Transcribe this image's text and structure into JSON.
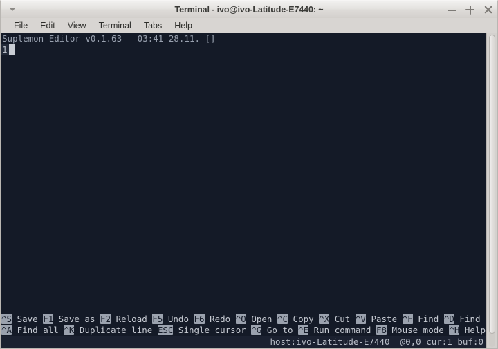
{
  "window": {
    "title": "Terminal - ivo@ivo-Latitude-E7440: ~",
    "menu_icon": "chevron-down-icon",
    "controls": {
      "minimize": "minimize-icon",
      "maximize": "maximize-icon",
      "close": "close-icon"
    }
  },
  "menubar": {
    "items": [
      {
        "label": "File"
      },
      {
        "label": "Edit"
      },
      {
        "label": "View"
      },
      {
        "label": "Terminal"
      },
      {
        "label": "Tabs"
      },
      {
        "label": "Help"
      }
    ]
  },
  "editor": {
    "header": "Suplemon Editor v0.1.63 - 03:41 28.11. []",
    "line_number": "1",
    "line_text": "",
    "cursor": "block-cursor"
  },
  "shortcuts": {
    "row1": [
      {
        "key": "^S",
        "label": "Save"
      },
      {
        "key": "F1",
        "label": "Save as"
      },
      {
        "key": "F2",
        "label": "Reload"
      },
      {
        "key": "F5",
        "label": "Undo"
      },
      {
        "key": "F6",
        "label": "Redo"
      },
      {
        "key": "^O",
        "label": "Open"
      },
      {
        "key": "^C",
        "label": "Copy"
      },
      {
        "key": "^X",
        "label": "Cut"
      },
      {
        "key": "^V",
        "label": "Paste"
      },
      {
        "key": "^F",
        "label": "Find"
      },
      {
        "key": "^D",
        "label": "Find next"
      }
    ],
    "row2": [
      {
        "key": "^A",
        "label": "Find all"
      },
      {
        "key": "^K",
        "label": "Duplicate line"
      },
      {
        "key": "ESC",
        "label": "Single cursor"
      },
      {
        "key": "^G",
        "label": "Go to"
      },
      {
        "key": "^E",
        "label": "Run command"
      },
      {
        "key": "F8",
        "label": "Mouse mode"
      },
      {
        "key": "^H",
        "label": "Help"
      }
    ]
  },
  "status": {
    "host": "host:ivo-Latitude-E7440",
    "position": "@0,0",
    "cursors": "cur:1",
    "buffer": "buf:0",
    "full": "host:ivo-Latitude-E7440  @0,0 cur:1 buf:0"
  },
  "colors": {
    "terminal_bg": "#141a27",
    "terminal_fg": "#c8ccd4",
    "key_bg": "#9ba2ae",
    "chrome_bg": "#d6d3d0",
    "status_bg": "#1b2130"
  }
}
